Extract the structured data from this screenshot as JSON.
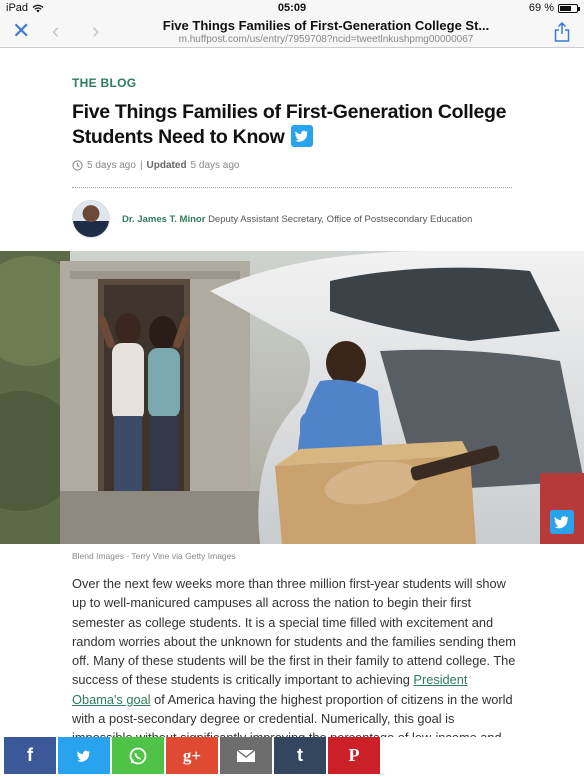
{
  "status": {
    "device": "iPad",
    "time": "05:09",
    "battery_text": "69 %",
    "battery_level": 0.69
  },
  "nav": {
    "title": "Five Things Families of First-Generation College St...",
    "url": "m.huffpost.com/us/entry/7959708?ncid=tweetlnkushpmg00000067"
  },
  "article": {
    "section": "THE BLOG",
    "headline": "Five Things Families of First-Generation College Students Need to Know",
    "meta_time": "5 days ago",
    "meta_separator": "|",
    "meta_updated_label": "Updated",
    "meta_updated_time": "5 days ago",
    "author_name": "Dr. James T. Minor",
    "author_title": "Deputy Assistant Secretary, Office of Postsecondary Education",
    "image_caption": "Blend Images - Terry Vine via Getty Images",
    "body_before_link": "Over the next few weeks more than three million first-year students will show up to well-manicured campuses all across the nation to begin their first semester as college students.  It is a special time filled with excitement and random worries about the unknown for students and the families sending them off.  Many of these students will be the first in their family to attend college. The success of these students is critically important to achieving ",
    "body_link": "President Obama's goal",
    "body_after_link": " of America having the highest proportion of citizens in the world with a post-secondary degree or credential. Numerically, this goal is impossible without significantly improving the percentage of low-income and first-generation students who not"
  },
  "share": {
    "buttons": [
      {
        "label": "f",
        "color": "#3b5998",
        "name": "facebook"
      },
      {
        "label": "twitter",
        "color": "#2aa3ef",
        "name": "twitter"
      },
      {
        "label": "whatsapp",
        "color": "#4fc248",
        "name": "whatsapp"
      },
      {
        "label": "g+",
        "color": "#df4a32",
        "name": "google-plus"
      },
      {
        "label": "email",
        "color": "#6d6d6d",
        "name": "email"
      },
      {
        "label": "t",
        "color": "#34465d",
        "name": "tumblr"
      },
      {
        "label": "P",
        "color": "#cb2027",
        "name": "pinterest"
      }
    ]
  }
}
